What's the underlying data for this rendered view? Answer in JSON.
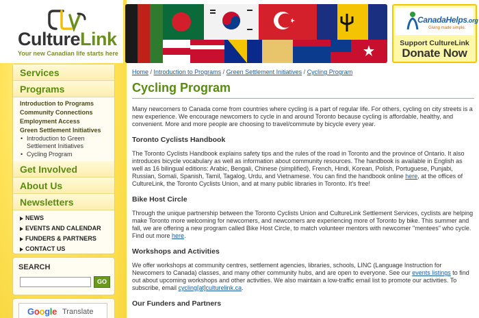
{
  "logo": {
    "brand_part1": "Culture",
    "brand_part2": "Link",
    "tagline": "Your new Canadian life starts here"
  },
  "donate": {
    "org_name": "CanadaHelps",
    "org_suffix": ".org",
    "org_tagline": "Giving made simple.",
    "line1": "Support CultureLink",
    "line2": "Donate Now"
  },
  "sidebar": {
    "services": "Services",
    "programs": "Programs",
    "program_links": [
      "Introduction to Programs",
      "Community Connections",
      "Employment Access",
      "Green Settlement Initiatives"
    ],
    "sub_links": [
      "Introduction to Green Settlement Initiatives",
      "Cycling Program"
    ],
    "get_involved": "Get Involved",
    "about_us": "About Us",
    "newsletters": "Newsletters",
    "news_links": [
      "NEWS",
      "EVENTS AND CALENDAR",
      "FUNDERS & PARTNERS",
      "CONTACT US"
    ]
  },
  "search": {
    "title": "SEARCH",
    "value": "",
    "button": "GO"
  },
  "translate": {
    "g": "G",
    "o1": "o",
    "o2": "o",
    "g2": "g",
    "l": "l",
    "e": "e",
    "label": "Translate"
  },
  "breadcrumb": {
    "home": "Home",
    "sep": " / ",
    "intro": "Introduction to Programs",
    "green": "Green Settlement Initiatives",
    "cycling": "Cycling Program"
  },
  "main": {
    "title": "Cycling Program",
    "intro": "Many newcomers to Canada come from countries where cycling is a part of regular life. For others, cycling on city streets is a new experience. We encourage newcomers to cycle in and around Toronto because cycling is affordable, healthy, and convenient. More and more people are choosing to travel/commute by bicycle every year.",
    "handbook_heading": "Toronto Cyclists Handbook",
    "handbook_text_a": "The Toronto Cyclists Handbook explains safety tips and the rules of the road in Toronto and the province of Ontario. It also introduces bicycle vocabulary as well as information about community resources. The handbook is available in English as well as 16 bilingual editions: Arabic, Bengali, Chinese (simplified), French, Hindi, Korean, Polish, Portuguese, Punjabi, Russian, Somali, Spanish, Tamil, Tagalog, Urdu, and Vietnamese. You can find the handbook online ",
    "handbook_link": "here",
    "handbook_text_b": ", at the offices of CultureLink, the Toronto Cyclists Union, and at many public libraries in Toronto. It's free!",
    "host_heading": "Bike Host Circle",
    "host_text_a": "Through the unique partnership between the Toronto Cyclists Union and CultureLink Settlement Services, cyclists are helping make Toronto more welcoming for newcomers, and newcomers are experiencing more of Toronto by bike. This summer and fall, we are offering a new program called Bike Host Circle, to match volunteer mentors with newcomer \"mentees\" who cycle. Find out more ",
    "host_link": "here",
    "host_text_b": ".",
    "workshops_heading": "Workshops and Activities",
    "workshops_text_a": "We offer workshops at community centres, settlement agencies, libraries, schools, LINC (Language Instruction for Newcomers to Canada) classes, and many other community hubs, and are open to everyone. See our ",
    "workshops_link": "events listings",
    "workshops_text_b": " to find out about upcoming workshops and other activities. We also maintain a low-traffic email list to promote our activities. To subscribe, email ",
    "workshops_email": "cycling[at]culturelink.ca",
    "workshops_text_c": ".",
    "funders_heading": "Our Funders and Partners"
  },
  "colors": {
    "accent_green": "#5a8a12",
    "link_blue": "#1a5aa0",
    "sidebar_yellow": "#ffe35a"
  }
}
